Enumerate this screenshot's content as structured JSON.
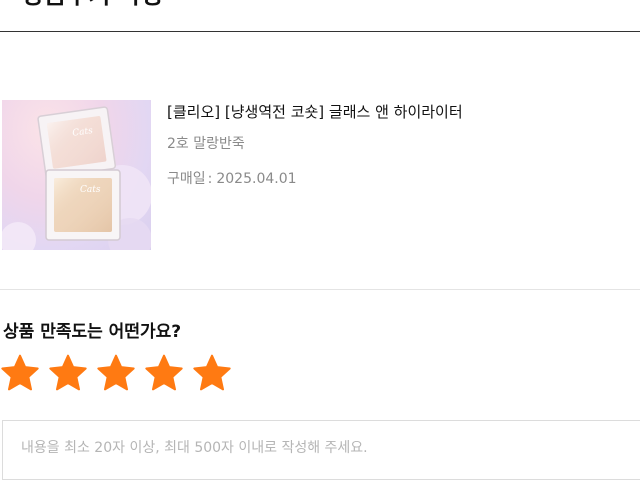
{
  "page": {
    "title": "상품후기 작성"
  },
  "product": {
    "name": "[클리오] [냥생역전 코숏] 글래스 앤 하이라이터",
    "option": "2호 말랑반죽",
    "purchase_date_label": "구매일",
    "purchase_date_value": "2025.04.01"
  },
  "rating": {
    "question": "상품 만족도는 어떤가요?",
    "value": 5,
    "max": 5,
    "star_color": "#ff7a12"
  },
  "review": {
    "placeholder": "내용을 최소 20자 이상, 최대 500자 이내로 작성해 주세요.",
    "value": ""
  }
}
